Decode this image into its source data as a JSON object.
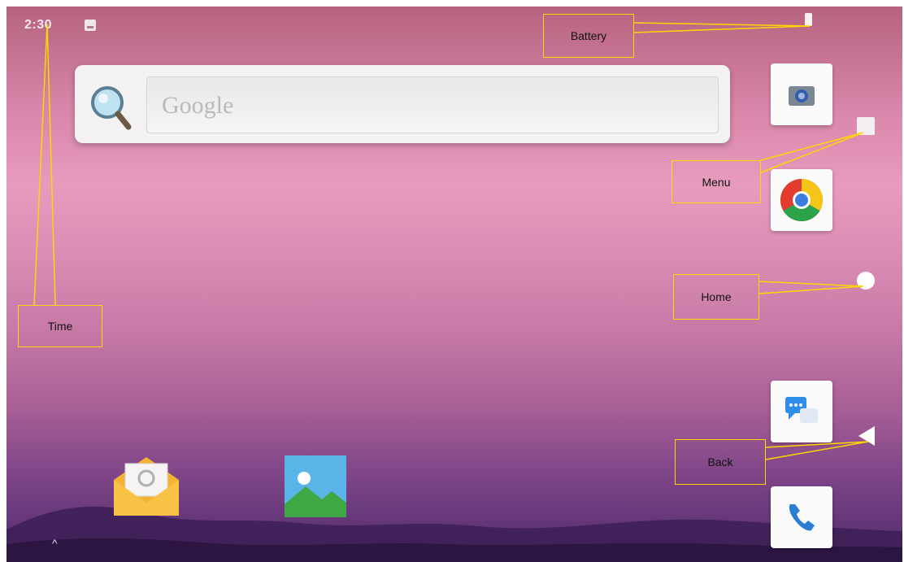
{
  "status_bar": {
    "time": "2:30",
    "notification_icon": "image-notification-icon",
    "battery_icon": "battery-icon"
  },
  "search_widget": {
    "placeholder": "Google",
    "icon": "magnifier-icon"
  },
  "right_dock": [
    {
      "name": "camera",
      "icon": "camera-icon"
    },
    {
      "name": "chrome",
      "icon": "chrome-icon"
    },
    {
      "name": "messaging",
      "icon": "messaging-icon"
    },
    {
      "name": "phone",
      "icon": "phone-icon"
    }
  ],
  "home_apps": [
    {
      "name": "email",
      "icon": "email-icon"
    },
    {
      "name": "gallery",
      "icon": "gallery-icon"
    }
  ],
  "nav_bar": {
    "menu_icon": "menu-square-icon",
    "home_icon": "home-circle-icon",
    "back_icon": "back-triangle-icon"
  },
  "app_drawer_handle": "^",
  "annotations": {
    "battery": "Battery",
    "menu": "Menu",
    "home": "Home",
    "time": "Time",
    "back": "Back"
  },
  "colors": {
    "annotation_border": "#ffd600",
    "wallpaper_top": "#b6627f",
    "wallpaper_bottom": "#4f2a6b"
  }
}
